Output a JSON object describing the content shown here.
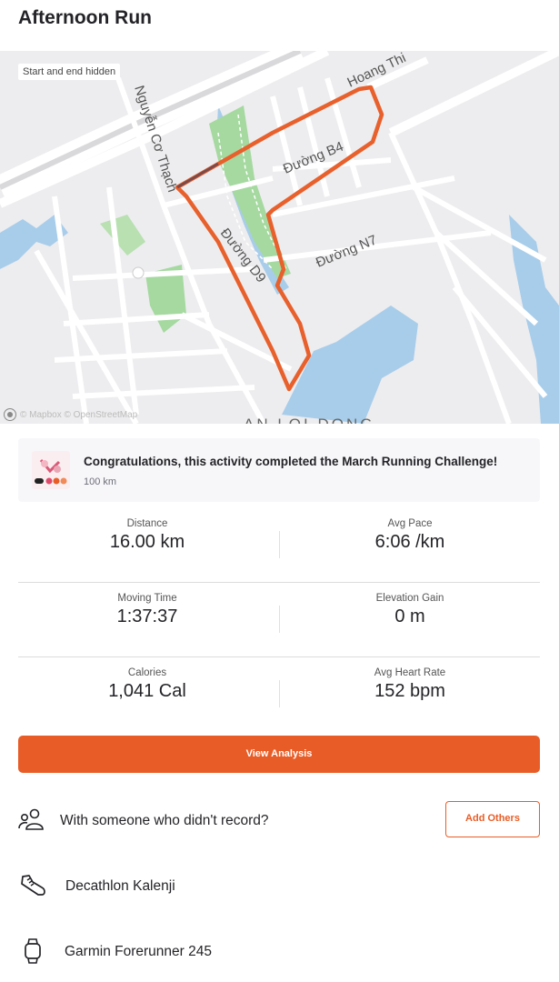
{
  "header": {
    "title": "Afternoon Run"
  },
  "map": {
    "badge": "Start and end hidden",
    "attribution": "© Mapbox © OpenStreetMap",
    "labels": {
      "road_top": "Hoang Thi",
      "road_left": "Nguyễn Cơ Thạch",
      "road_b4": "Đường B4",
      "road_d9": "Đường D9",
      "road_n7": "Đường N7",
      "area": "AN LOI DONG"
    },
    "route_color": "#e8602c"
  },
  "challenge": {
    "title": "Congratulations, this activity completed the March Running Challenge!",
    "subtitle": "100 km"
  },
  "stats": [
    {
      "label": "Distance",
      "value": "16.00 km"
    },
    {
      "label": "Avg Pace",
      "value": "6:06 /km"
    },
    {
      "label": "Moving Time",
      "value": "1:37:37"
    },
    {
      "label": "Elevation Gain",
      "value": "0 m"
    },
    {
      "label": "Calories",
      "value": "1,041 Cal"
    },
    {
      "label": "Avg Heart Rate",
      "value": "152 bpm"
    }
  ],
  "actions": {
    "view_analysis": "View Analysis",
    "with_someone": "With someone who didn't record?",
    "add_others": "Add Others"
  },
  "gear": {
    "shoes": "Decathlon Kalenji",
    "device": "Garmin Forerunner 245"
  },
  "colors": {
    "accent": "#e85d27"
  }
}
